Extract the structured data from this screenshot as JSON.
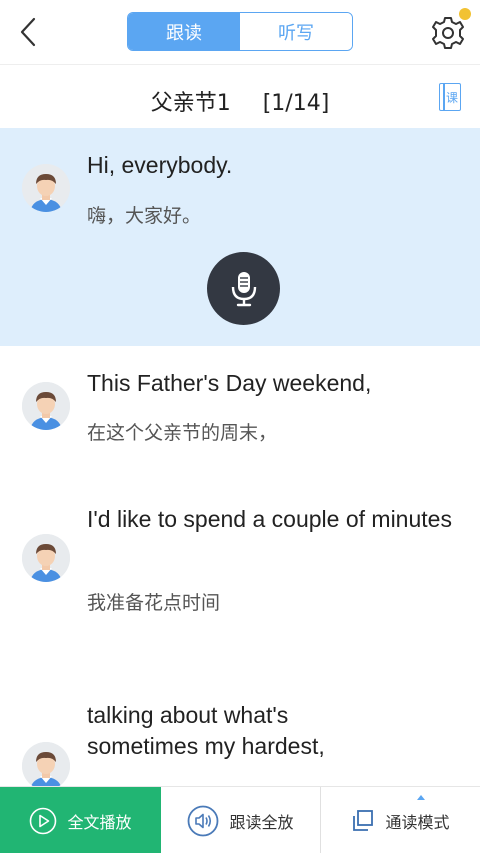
{
  "header": {
    "tabs": [
      {
        "label": "跟读",
        "active": true
      },
      {
        "label": "听写",
        "active": false
      }
    ],
    "notification_color": "#f2c232",
    "accent_color": "#5ba6f2"
  },
  "lesson": {
    "title": "父亲节1",
    "progress": "[1/14]",
    "book_icon_label": "课"
  },
  "sentences": [
    {
      "en": "Hi, everybody.",
      "zh": "嗨，大家好。",
      "active": true
    },
    {
      "en": "This Father's Day weekend,",
      "zh": "在这个父亲节的周末，",
      "active": false
    },
    {
      "en": "I'd like to spend a couple of minutes",
      "zh": "我准备花点时间",
      "active": false
    },
    {
      "en": "talking about what's sometimes my hardest,",
      "zh": "",
      "active": false
    }
  ],
  "bottom": {
    "play_all": "全文播放",
    "follow_all": "跟读全放",
    "mode": "通读模式",
    "play_color": "#21b573"
  },
  "icons": {
    "back": "back-chevron-icon",
    "settings": "gear-icon",
    "book": "book-icon",
    "mic": "microphone-icon",
    "play": "play-circle-icon",
    "speaker": "speaker-circle-icon",
    "copy": "copy-pages-icon"
  }
}
